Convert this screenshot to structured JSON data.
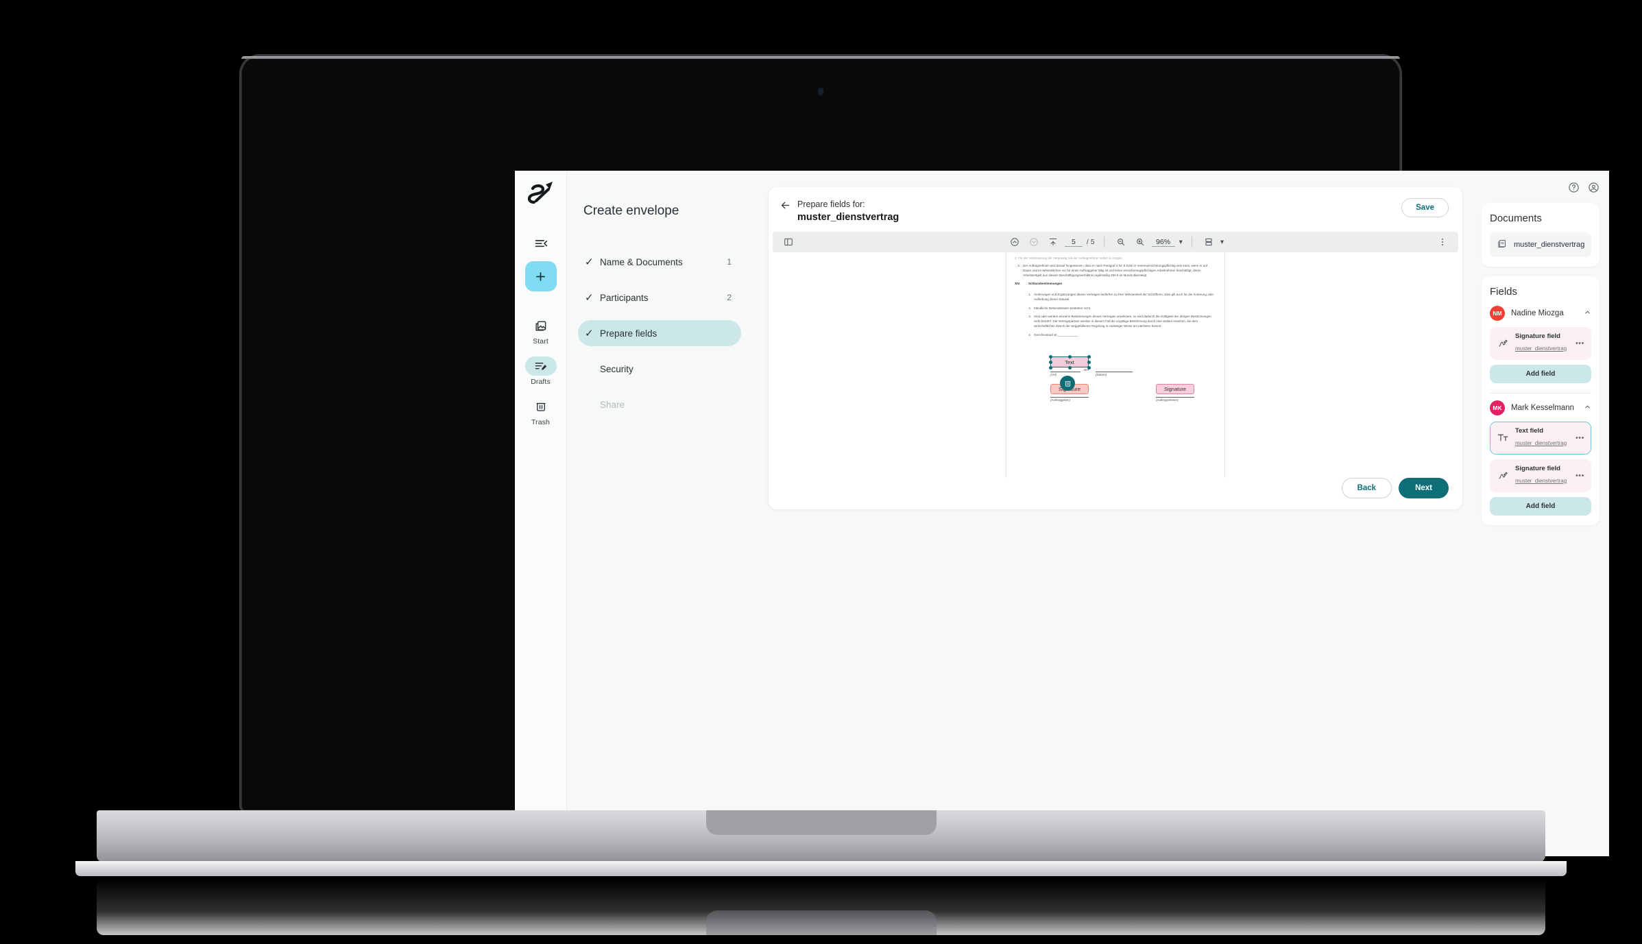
{
  "rail": {
    "brand_icon": "signature-s-logo",
    "collapse_icon": "collapse-sidebar-icon",
    "add_icon": "plus-icon",
    "items": [
      {
        "label": "Start",
        "icon": "start-image-icon",
        "active": false
      },
      {
        "label": "Drafts",
        "icon": "drafts-edit-icon",
        "active": true
      },
      {
        "label": "Trash",
        "icon": "trash-icon",
        "active": false
      }
    ],
    "theme_icon": "brightness-sun-icon"
  },
  "steps": {
    "title": "Create envelope",
    "items": [
      {
        "label": "Name & Documents",
        "count": "1",
        "checked": true,
        "active": false,
        "muted": false
      },
      {
        "label": "Participants",
        "count": "2",
        "checked": true,
        "active": false,
        "muted": false
      },
      {
        "label": "Prepare fields",
        "count": "",
        "checked": true,
        "active": true,
        "muted": false
      },
      {
        "label": "Security",
        "count": "",
        "checked": false,
        "active": false,
        "muted": false
      },
      {
        "label": "Share",
        "count": "",
        "checked": false,
        "active": false,
        "muted": true
      }
    ],
    "check_glyph": "✓"
  },
  "card": {
    "back_icon": "back-arrow-icon",
    "subtitle": "Prepare fields for:",
    "title": "muster_dienstvertrag",
    "save_label": "Save",
    "back_label": "Back",
    "next_label": "Next"
  },
  "pdf_toolbar": {
    "sidebar_icon": "panel-toggle-icon",
    "prev_icon": "page-up-icon",
    "next_icon": "page-down-icon",
    "fit_icon": "fit-to-top-icon",
    "page_current": "5",
    "page_total": "/ 5",
    "zoom_out_icon": "zoom-out-icon",
    "zoom_in_icon": "zoom-in-icon",
    "zoom_level": "96%",
    "zoom_caret": "▾",
    "layout_icon": "page-layout-icon",
    "layout_caret": "▾",
    "more_icon": "more-vertical-icon"
  },
  "document": {
    "clipped_line": "2.  Für die Versteuerung der Vergütung hat der Auftragnehmer selbst zu sorgen.",
    "paragraphs": [
      {
        "num": "3.",
        "text": "Der Auftragnehmer wird darauf hingewiesen, dass er nach Paragraf 2 Nr. 9 SGB VI rentenversicherungspflichtig sein kann, wenn er auf Dauer und im Wesentlichen nur für einen Auftraggeber tätig ist und keine versicherungspflichtigen Arbeitnehmer beschäftigt, deren Arbeitsentgelt aus diesem Beschäftigungsverhältnis regelmäßig  450 € im Monat übersteigt."
      }
    ],
    "section_roman": "XIV.",
    "section_heading": "Schlussbestimmungen",
    "section_items": [
      {
        "num": "1.",
        "text": "Änderungen und Ergänzungen dieses Vertrages bedürfen zu ihrer Wirksamkeit der Schriftform. Dies gilt auch für die Änderung oder Aufhebung dieser Klausel."
      },
      {
        "num": "2.",
        "text": "Mündliche Nebenabreden bestehen nicht."
      },
      {
        "num": "3.",
        "text": "Sind oder werden einzelne Bestimmungen dieses Vertrages unwirksam, so wird dadurch die Gültigkeit der übrigen Bestimmungen nicht berührt. Die Vertragspartner werden in diesem Fall die ungültige Bestimmung durch eine andere ersetzen, die dem wirtschaftlichen Zweck der weggefallenen Regelung in zulässiger Weise am nächsten kommt."
      },
      {
        "num": "4.",
        "text": "Gerichtsstand ist ____________"
      }
    ],
    "signature_labels": {
      "ort": "(Ort)",
      "den": ", den",
      "datum": "(Datum)",
      "auftraggeber": "(Auftraggeber)",
      "auftragnehmer": "(Auftragnehmer)"
    },
    "overlay_fields": [
      {
        "label": "Text",
        "type": "text",
        "selected": true
      },
      {
        "label": "Signature",
        "type": "signature",
        "selected": false
      },
      {
        "label": "Signature",
        "type": "signature",
        "selected": false
      }
    ],
    "delete_icon": "delete-trash-icon"
  },
  "topbar": {
    "help_icon": "help-circle-icon",
    "account_icon": "account-circle-icon"
  },
  "documents_panel": {
    "heading": "Documents",
    "items": [
      {
        "name": "muster_dienstvertrag",
        "icon": "pdf-file-icon"
      }
    ]
  },
  "fields_panel": {
    "heading": "Fields",
    "collapse_glyph": "˄",
    "menu_glyph": "•••",
    "groups": [
      {
        "initials": "NM",
        "name": "Nadine Miozga",
        "color": "#EE4136",
        "add_label": "Add field",
        "fields": [
          {
            "title": "Signature field",
            "document": "muster_dienstvertrag",
            "icon": "signature-pen-icon",
            "selected": false
          }
        ]
      },
      {
        "initials": "MK",
        "name": "Mark Kesselmann",
        "color": "#E61E63",
        "add_label": "Add field",
        "fields": [
          {
            "title": "Text field",
            "document": "muster_dienstvertrag",
            "icon": "text-tt-icon",
            "selected": true
          },
          {
            "title": "Signature field",
            "document": "muster_dienstvertrag",
            "icon": "signature-pen-icon",
            "selected": false
          }
        ]
      }
    ]
  },
  "colors": {
    "accent_teal": "#0D6E78",
    "accent_cyan": "#7FDCF2",
    "step_active": "#CBE7EA",
    "field_pink": "#FDF0F2",
    "selected_border": "#6EC9DE"
  }
}
